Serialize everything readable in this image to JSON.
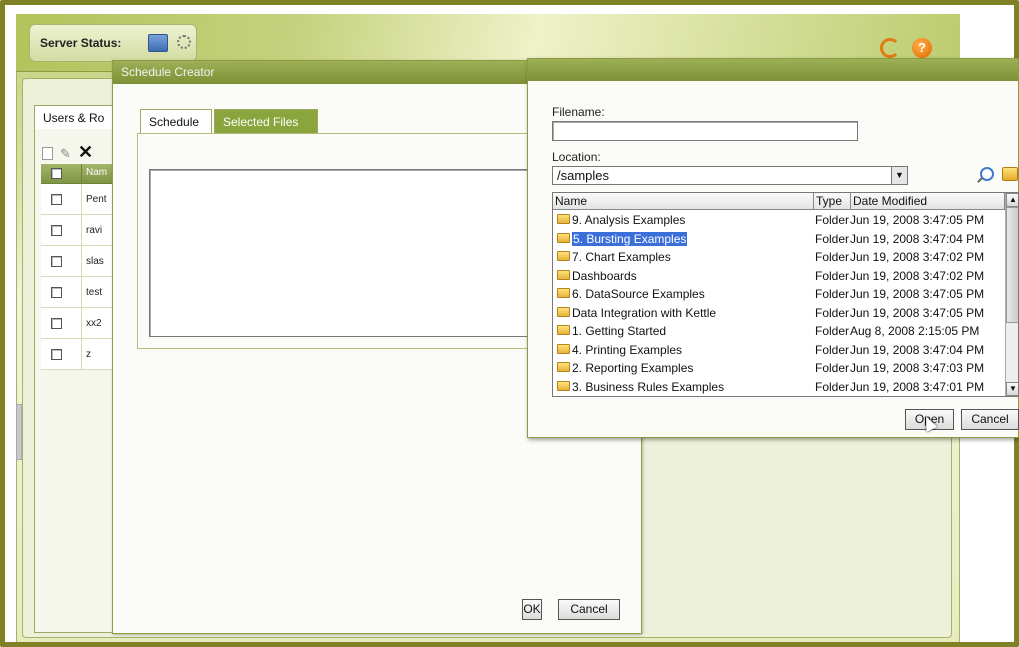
{
  "header": {
    "server_status_label": "Server Status:",
    "help_glyph": "?"
  },
  "users_panel": {
    "tab_label": "Users & Ro",
    "header_col": "Nam",
    "rows": [
      "Pent",
      "ravi",
      "slas",
      "test",
      "xx2",
      "z"
    ]
  },
  "schedule_creator": {
    "title": "Schedule Creator",
    "tabs": [
      "Schedule",
      "Selected Files"
    ],
    "ok_label": "OK",
    "cancel_label": "Cancel"
  },
  "file_dialog": {
    "filename_label": "Filename:",
    "filename_value": "",
    "location_label": "Location:",
    "location_value": "/samples",
    "columns": {
      "name": "Name",
      "type": "Type",
      "date": "Date Modified"
    },
    "rows": [
      {
        "name": "9. Analysis Examples",
        "type": "Folder",
        "date": "Jun 19, 2008 3:47:05 PM"
      },
      {
        "name": "5. Bursting Examples",
        "type": "Folder",
        "date": "Jun 19, 2008 3:47:04 PM"
      },
      {
        "name": "7. Chart Examples",
        "type": "Folder",
        "date": "Jun 19, 2008 3:47:02 PM"
      },
      {
        "name": "Dashboards",
        "type": "Folder",
        "date": "Jun 19, 2008 3:47:02 PM"
      },
      {
        "name": "6. DataSource Examples",
        "type": "Folder",
        "date": "Jun 19, 2008 3:47:05 PM"
      },
      {
        "name": "Data Integration with Kettle",
        "type": "Folder",
        "date": "Jun 19, 2008 3:47:05 PM"
      },
      {
        "name": "1. Getting Started",
        "type": "Folder",
        "date": "Aug 8, 2008 2:15:05 PM"
      },
      {
        "name": "4. Printing Examples",
        "type": "Folder",
        "date": "Jun 19, 2008 3:47:04 PM"
      },
      {
        "name": "2. Reporting Examples",
        "type": "Folder",
        "date": "Jun 19, 2008 3:47:03 PM"
      },
      {
        "name": "3. Business Rules Examples",
        "type": "Folder",
        "date": "Jun 19, 2008 3:47:01 PM"
      }
    ],
    "open_label": "Open",
    "cancel_label": "Cancel"
  },
  "colors": {
    "frame": "#7f8124",
    "title_bar": "#8a9c45",
    "selected_tab": "#8aa43e",
    "selection": "#3a6fd9"
  }
}
